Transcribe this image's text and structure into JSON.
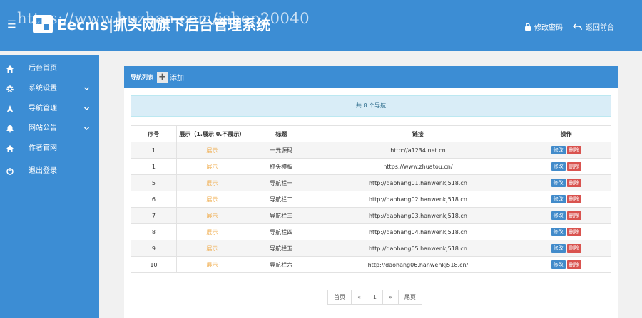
{
  "header": {
    "brand": "Eecms|抓头网旗下后台管理系统",
    "watermark": "https://www.huzhan.com/ishop20040",
    "change_password": "修改密码",
    "back_to_front": "返回前台",
    "menu_icon": "menu-icon"
  },
  "sidebar": {
    "items": [
      {
        "label": "后台首页",
        "icon": "home-icon"
      },
      {
        "label": "系统设置",
        "icon": "gear-icon"
      },
      {
        "label": "导航管理",
        "icon": "nav-icon"
      },
      {
        "label": "网站公告",
        "icon": "bell-icon"
      },
      {
        "label": "作者官网",
        "icon": "home-icon"
      },
      {
        "label": "退出登录",
        "icon": "power-icon"
      }
    ]
  },
  "panel": {
    "title": "导航列表",
    "add_label": "添加",
    "info": "共 8 个导航"
  },
  "table": {
    "headers": [
      "序号",
      "展示（1.展示 0.不展示）",
      "标题",
      "链接",
      "操作"
    ],
    "edit_label": "修改",
    "delete_label": "删除",
    "rows": [
      {
        "order": "1",
        "show": "展示",
        "title": "一元源码",
        "link": "http://a1234.net.cn"
      },
      {
        "order": "1",
        "show": "展示",
        "title": "抓头模板",
        "link": "https://www.zhuatou.cn/"
      },
      {
        "order": "5",
        "show": "展示",
        "title": "导航栏一",
        "link": "http://daohang01.hanwenkj518.cn"
      },
      {
        "order": "6",
        "show": "展示",
        "title": "导航栏二",
        "link": "http://daohang02.hanwenkj518.cn"
      },
      {
        "order": "7",
        "show": "展示",
        "title": "导航栏三",
        "link": "http://daohang03.hanwenkj518.cn"
      },
      {
        "order": "8",
        "show": "展示",
        "title": "导航栏四",
        "link": "http://daohang04.hanwenkj518.cn"
      },
      {
        "order": "9",
        "show": "展示",
        "title": "导航栏五",
        "link": "http://daohang05.hanwenkj518.cn"
      },
      {
        "order": "10",
        "show": "展示",
        "title": "导航栏六",
        "link": "http://daohang06.hanwenkj518.cn/"
      }
    ]
  },
  "pager": {
    "first": "首页",
    "prev": "«",
    "current": "1",
    "next": "»",
    "last": "尾页"
  },
  "colors": {
    "primary": "#3c8dd4",
    "show_text": "#f0ad4e",
    "edit_button": "#428bca",
    "delete_button": "#d9534f",
    "info_bg": "#d9edf7"
  }
}
